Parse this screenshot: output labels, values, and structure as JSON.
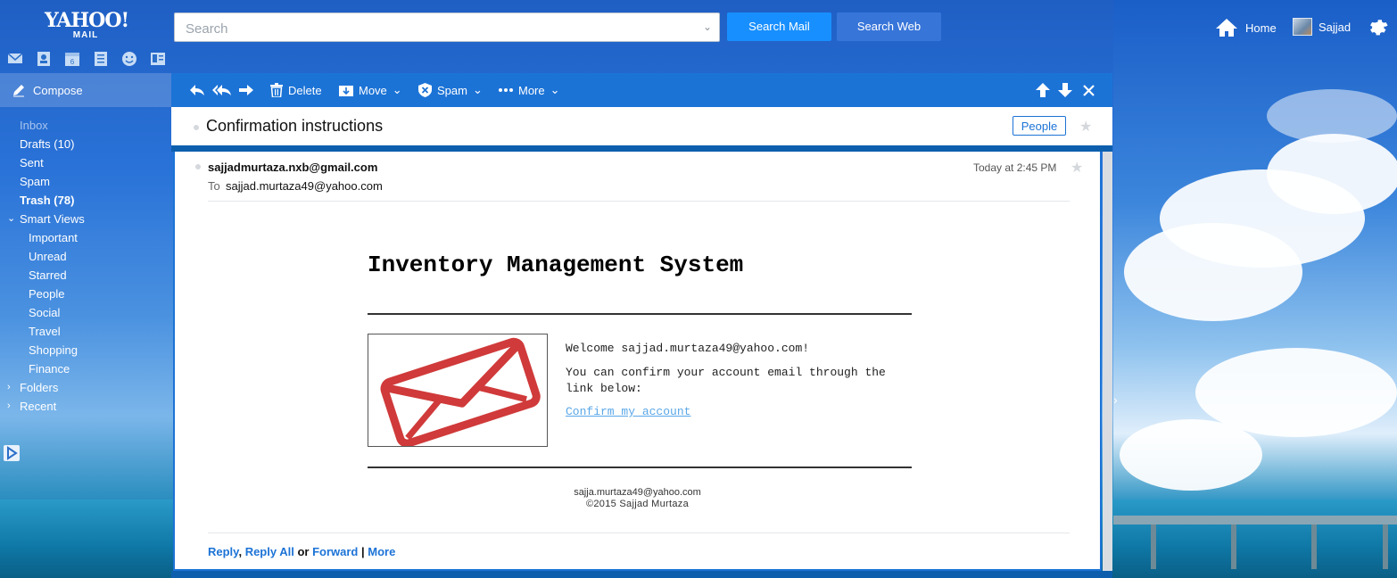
{
  "header": {
    "logo_main": "YAHOO!",
    "logo_sub": "MAIL",
    "search_placeholder": "Search",
    "search_mail": "Search Mail",
    "search_web": "Search Web",
    "home": "Home",
    "user": "Sajjad"
  },
  "apps": {
    "calendar_day": "6"
  },
  "nav": {
    "compose": "Compose",
    "inbox": "Inbox",
    "drafts": "Drafts (10)",
    "sent": "Sent",
    "spam": "Spam",
    "trash": "Trash (78)",
    "smart_views": "Smart Views",
    "important": "Important",
    "unread": "Unread",
    "starred": "Starred",
    "people": "People",
    "social": "Social",
    "travel": "Travel",
    "shopping": "Shopping",
    "finance": "Finance",
    "folders": "Folders",
    "recent": "Recent"
  },
  "toolbar": {
    "delete": "Delete",
    "move": "Move",
    "spam": "Spam",
    "more": "More"
  },
  "message": {
    "subject": "Confirmation instructions",
    "people_button": "People",
    "from": "sajjadmurtaza.nxb@gmail.com",
    "to_label": "To",
    "to": "sajjad.murtaza49@yahoo.com",
    "date": "Today at 2:45 PM",
    "body": {
      "title": "Inventory Management System",
      "welcome": "Welcome sajjad.murtaza49@yahoo.com!",
      "instructions": "You can confirm your account email through the link below:",
      "confirm_link": "Confirm my account",
      "footer_email": "sajja.murtaza49@yahoo.com",
      "footer_copyright": "©2015 Sajjad Murtaza"
    },
    "actions": {
      "reply": "Reply",
      "sep1": ",",
      "reply_all": "Reply All",
      "or": "or",
      "forward": "Forward",
      "sep2": "|",
      "more": "More"
    }
  },
  "colors": {
    "accent": "#1c73d6",
    "button_primary": "#188fff",
    "button_secondary": "#3775d9",
    "envelope": "#d03a3a",
    "link": "#5aa7e8"
  }
}
